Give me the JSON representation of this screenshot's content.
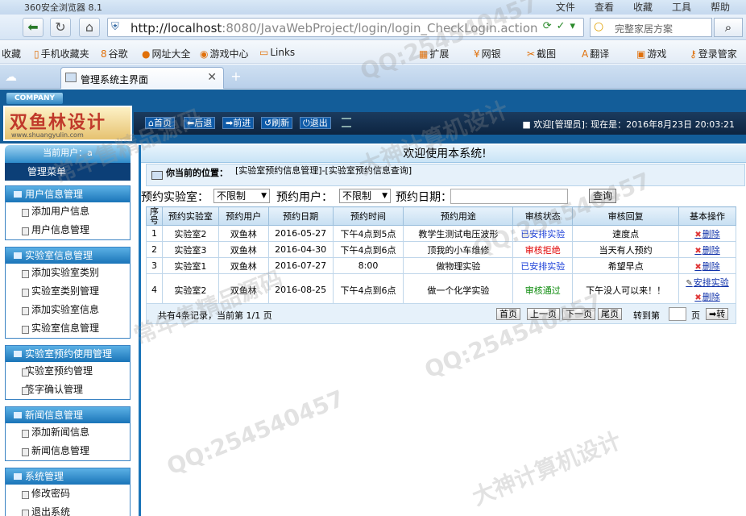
{
  "browser": {
    "title": "360安全浏览器 8.1",
    "menus": [
      "文件",
      "查看",
      "收藏",
      "工具",
      "帮助"
    ],
    "url_host": "http://localhost",
    "url_rest": ":8080/JavaWebProject/login/login_CheckLogin.action",
    "search_placeholder": "完整家居方案",
    "favorites": [
      "收藏",
      "手机收藏夹",
      "谷歌",
      "网址大全",
      "游戏中心",
      "Links",
      "扩展",
      "网银",
      "截图",
      "翻译",
      "游戏",
      "登录管家"
    ],
    "tab_label": "管理系统主界面"
  },
  "header": {
    "company": "COMPANY",
    "logo_text": "双鱼林设计",
    "logo_url": "www.shuangyulin.com",
    "nav": [
      "首页",
      "后退",
      "前进",
      "刷新",
      "退出"
    ],
    "welcome": "■ 欢迎[管理员]:   现在是：2016年8月23日  20:03:21"
  },
  "sidebar": {
    "current_user": "当前用户：a",
    "menu_title": "管理菜单",
    "groups": [
      {
        "title": "用户信息管理",
        "items": [
          "添加用户信息",
          "用户信息管理"
        ]
      },
      {
        "title": "实验室信息管理",
        "items": [
          "添加实验室类别",
          "实验室类别管理",
          "添加实验室信息",
          "实验室信息管理"
        ]
      },
      {
        "title": "实验室预约使用管理",
        "items": [
          "实验室预约管理",
          "签字确认管理"
        ]
      },
      {
        "title": "新闻信息管理",
        "items": [
          "添加新闻信息",
          "新闻信息管理"
        ]
      },
      {
        "title": "系统管理",
        "items": [
          "修改密码",
          "退出系统"
        ]
      }
    ]
  },
  "content": {
    "banner": "欢迎使用本系统!",
    "crumb_label": "你当前的位置：",
    "crumb_value": "[实验室预约信息管理]-[实验室预约信息查询]",
    "filters": {
      "lab_label": "预约实验室：",
      "lab_value": "不限制",
      "user_label": "预约用户：",
      "user_value": "不限制",
      "date_label": "预约日期：",
      "date_value": "",
      "query_button": "查询"
    },
    "columns": [
      "序号",
      "预约实验室",
      "预约用户",
      "预约日期",
      "预约时间",
      "预约用途",
      "审核状态",
      "审核回复",
      "基本操作"
    ],
    "rows": [
      {
        "no": "1",
        "lab": "实验室2",
        "user": "双鱼林",
        "date": "2016-05-27",
        "time": "下午4点到5点",
        "purpose": "教学生测试电压波形",
        "status": "已安排实验",
        "reply": "速度点",
        "ops": [
          "删除"
        ]
      },
      {
        "no": "2",
        "lab": "实验室3",
        "user": "双鱼林",
        "date": "2016-04-30",
        "time": "下午4点到6点",
        "purpose": "顶我的小车维修",
        "status": "审核拒绝",
        "reply": "当天有人预约",
        "ops": [
          "删除"
        ]
      },
      {
        "no": "3",
        "lab": "实验室1",
        "user": "双鱼林",
        "date": "2016-07-27",
        "time": "8:00",
        "purpose": "做物理实验",
        "status": "已安排实验",
        "reply": "希望早点",
        "ops": [
          "删除"
        ]
      },
      {
        "no": "4",
        "lab": "实验室2",
        "user": "双鱼林",
        "date": "2016-08-25",
        "time": "下午4点到6点",
        "purpose": "做一个化学实验",
        "status": "审核通过",
        "reply": "下午没人可以来！！",
        "ops": [
          "安排实验",
          "删除"
        ]
      }
    ],
    "pager": {
      "info": "共有4条记录，当前第 1/1 页",
      "first": "首页",
      "prev": "上一页",
      "next": "下一页",
      "last": "尾页",
      "goto_label": "转到第",
      "page_label": "页",
      "go": "➡转"
    }
  },
  "watermarks": [
    "QQ:254540457",
    "大神计算机设计",
    "常年售精品源码"
  ]
}
